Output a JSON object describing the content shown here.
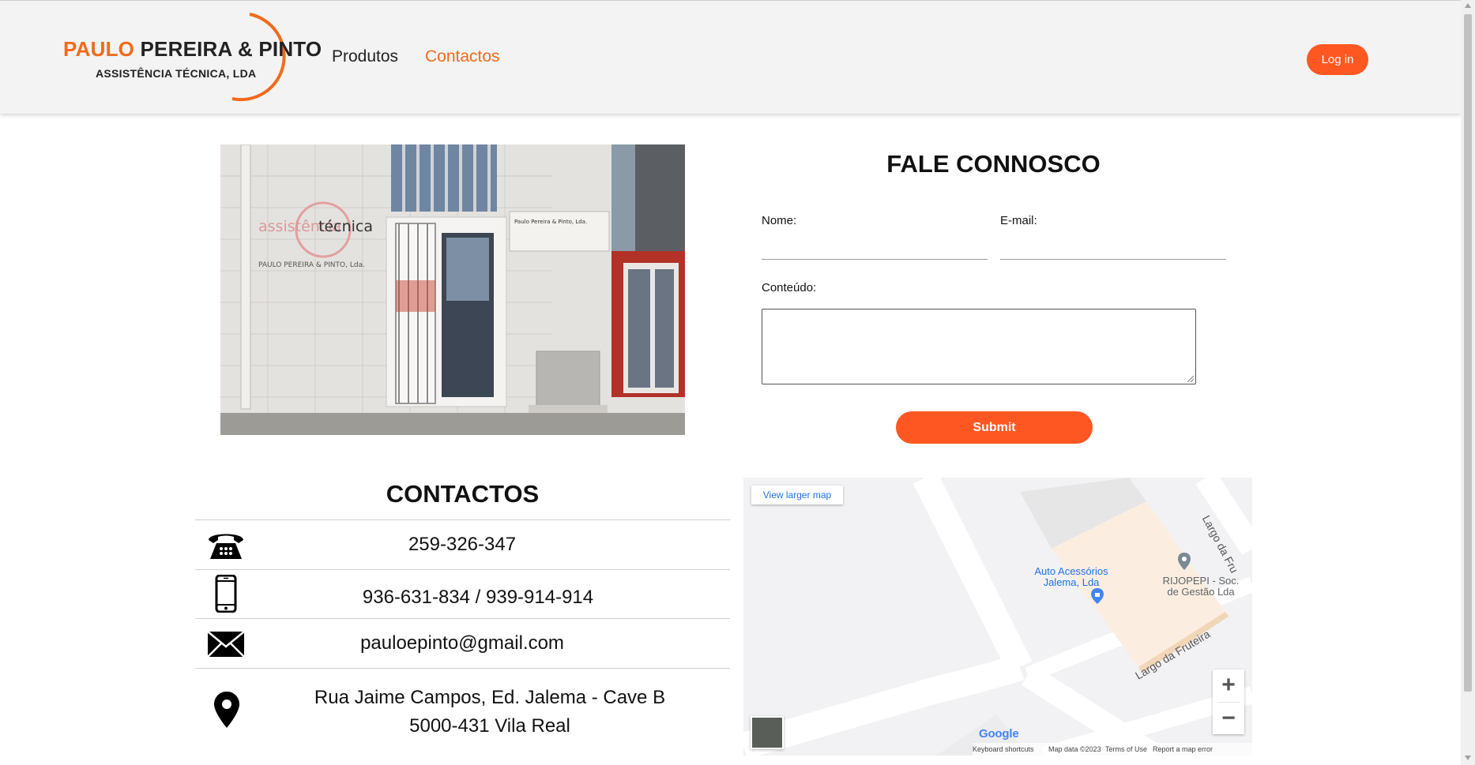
{
  "header": {
    "logo": {
      "line1_orange": "PAULO",
      "line1_dark": "PEREIRA & PINTO",
      "line2": "ASSISTÊNCIA TÉCNICA, LDA"
    },
    "nav": [
      {
        "label": "Produtos"
      },
      {
        "label": "Contactos"
      }
    ],
    "login_label": "Log in"
  },
  "store_photo": {
    "sign_text_1": "assistência",
    "sign_text_2": "técnica",
    "sign_subtext": "PAULO PEREIRA & PINTO, Lda.",
    "plate_text": "Paulo Pereira & Pinto, Lda."
  },
  "form": {
    "title": "FALE CONNOSCO",
    "nome_label": "Nome:",
    "email_label": "E-mail:",
    "conteudo_label": "Conteúdo:",
    "submit_label": "Submit"
  },
  "contacts": {
    "title": "CONTACTOS",
    "phone": "259-326-347",
    "mobile": "936-631-834 / 939-914-914",
    "email": "pauloepinto@gmail.com",
    "address_line1": "Rua Jaime Campos, Ed. Jalema - Cave B",
    "address_line2": "5000-431 Vila Real",
    "icons": [
      "phone-icon",
      "mobile-icon",
      "mail-icon",
      "location-pin-icon"
    ]
  },
  "map": {
    "view_larger": "View larger map",
    "place1_line1": "Auto Acessórios",
    "place1_line2": "Jalema, Lda",
    "place2_line1": "RIJOPEPI - Soc.",
    "place2_line2": "de Gestão Lda",
    "street1": "Largo da Fruteira",
    "street2": "Largo da Fru",
    "zoom_in": "+",
    "zoom_out": "−",
    "google": "Google",
    "footer": {
      "shortcuts": "Keyboard shortcuts",
      "map_data": "Map data ©2023",
      "terms": "Terms of Use",
      "report": "Report a map error"
    }
  },
  "colors": {
    "accent": "#ff5722",
    "brand_orange": "#f26a1b",
    "header_bg": "#f3f3f3"
  }
}
